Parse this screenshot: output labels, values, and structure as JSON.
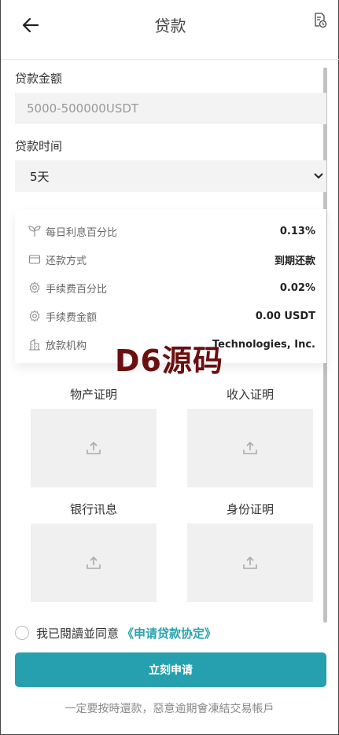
{
  "header": {
    "title": "贷款",
    "back_icon": "arrow-left-icon",
    "record_icon": "document-clock-icon"
  },
  "form": {
    "amount_label": "贷款金额",
    "amount_placeholder": "5000-500000USDT",
    "term_label": "贷款时间",
    "term_value": "5天"
  },
  "info": [
    {
      "icon": "sprout-icon",
      "label": "每日利息百分比",
      "value": "0.13%"
    },
    {
      "icon": "wallet-icon",
      "label": "还款方式",
      "value": "到期还款"
    },
    {
      "icon": "gear-icon",
      "label": "手续费百分比",
      "value": "0.02%"
    },
    {
      "icon": "gear-icon",
      "label": "手续费金额",
      "value": "0.00 USDT"
    },
    {
      "icon": "building-icon",
      "label": "放款机构",
      "value": "Technologies, Inc."
    }
  ],
  "watermark": "D6源码",
  "documents": [
    {
      "title": "物产证明"
    },
    {
      "title": "收入证明"
    },
    {
      "title": "银行讯息"
    },
    {
      "title": "身份证明"
    }
  ],
  "agreement": {
    "text": "我已閱讀並同意",
    "link": "《申请贷款协定》"
  },
  "submit_label": "立刻申请",
  "footer_note": "一定要按時還款，惡意逾期會凍結交易帳戶",
  "colors": {
    "accent": "#26a0ae",
    "link": "#2aa3b0",
    "watermark": "#6b0f0f"
  }
}
